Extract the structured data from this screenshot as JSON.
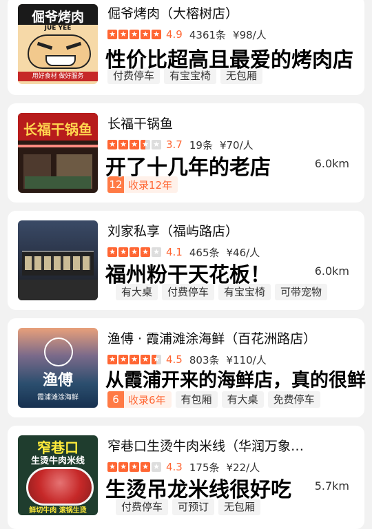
{
  "colors": {
    "accent": "#ff6633",
    "tag_bg": "#f3f3f3"
  },
  "cards": [
    {
      "name": "倔爷烤肉（大榕树店）",
      "score": "4.9",
      "reviews": "4361条",
      "price": "¥98/人",
      "slogan": "性价比超高且最爱的烤肉店",
      "distance": "",
      "logo_title": "倔爷烤肉",
      "logo_sub": "JUE YEE",
      "logo_foot": "用好食材 做好服务",
      "tags": [
        "付费停车",
        "有宝宝椅",
        "无包厢"
      ]
    },
    {
      "name": "长福干锅鱼",
      "score": "3.7",
      "reviews": "19条",
      "price": "¥70/人",
      "slogan": "开了十几年的老店",
      "distance": "6.0km",
      "logo_title": "长福干锅鱼",
      "fav_num": "12",
      "fav_text": "收录12年"
    },
    {
      "name": "刘家私享（福屿路店）",
      "score": "4.1",
      "reviews": "465条",
      "price": "¥46/人",
      "slogan": "福州粉干天花板！",
      "distance": "6.0km",
      "tags": [
        "有大桌",
        "付费停车",
        "有宝宝椅",
        "可带宠物"
      ]
    },
    {
      "name": "渔傅 · 霞浦滩涂海鲜（百花洲路店）",
      "score": "4.5",
      "reviews": "803条",
      "price": "¥110/人",
      "slogan": "从霞浦开来的海鲜店，真的很鲜",
      "distance": "",
      "logo_title": "渔傅",
      "logo_sub": "霞浦滩涂海鲜",
      "fav_num": "6",
      "fav_text": "收录6年",
      "tags": [
        "有包厢",
        "有大桌",
        "免费停车"
      ]
    },
    {
      "name": "窄巷口生烫牛肉米线（华润万象…",
      "score": "4.3",
      "reviews": "175条",
      "price": "¥22/人",
      "slogan": "生烫吊龙米线很好吃",
      "distance": "5.7km",
      "logo_title": "窄巷口",
      "logo_sub": "生烫牛肉米线",
      "logo_foot": "鲜切牛肉 滚锅生烫",
      "tags": [
        "付费停车",
        "可预订",
        "无包厢"
      ]
    }
  ]
}
